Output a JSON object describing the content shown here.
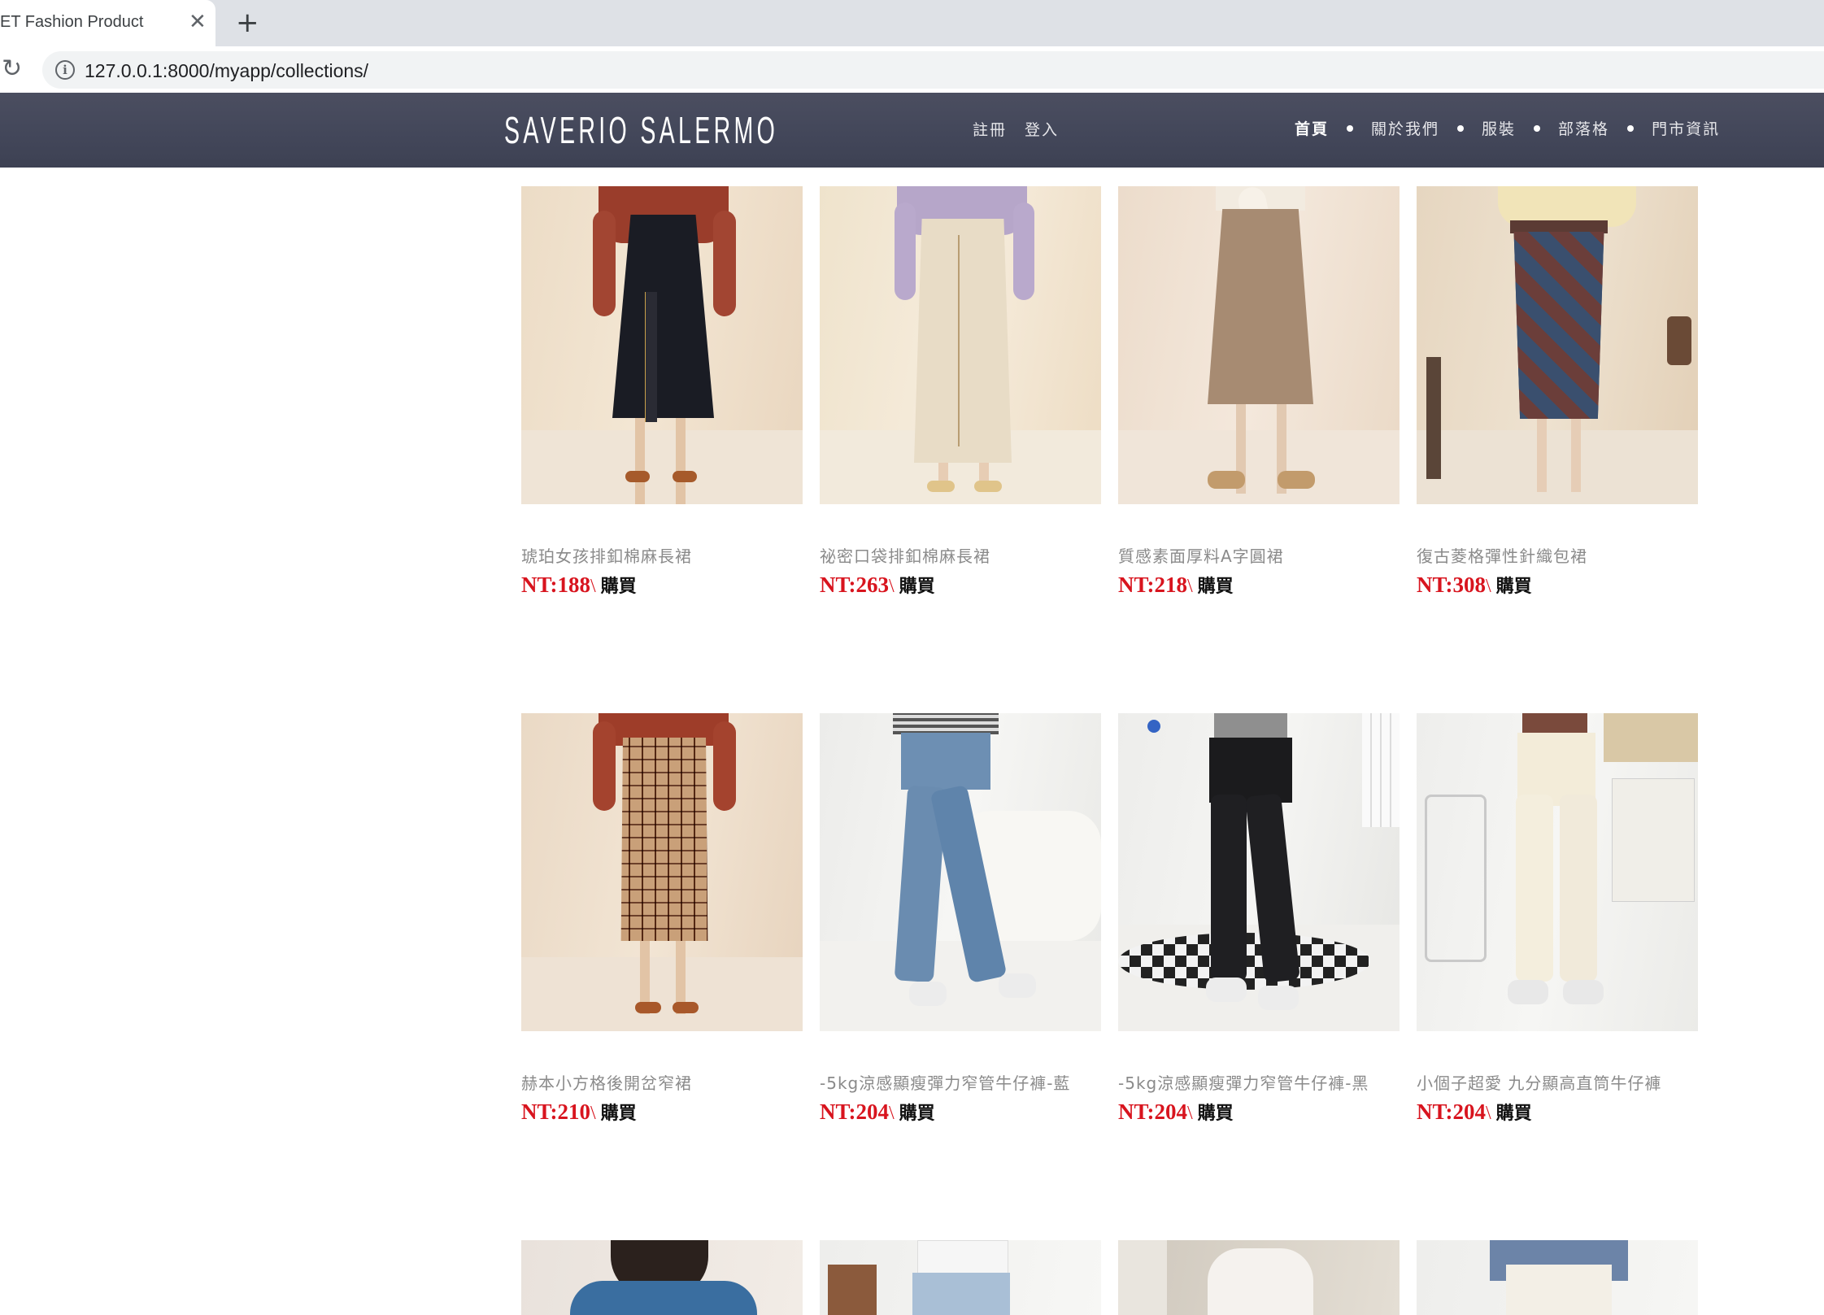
{
  "browser": {
    "tab_title": "ET Fashion Product",
    "close_glyph": "✕",
    "new_tab_glyph": "+",
    "reload_glyph": "↻",
    "info_glyph": "i",
    "url": "127.0.0.1:8000/myapp/collections/"
  },
  "header": {
    "logo": "SAVERIO SALERMO",
    "auth": [
      "註冊",
      "登入"
    ],
    "nav": [
      "首頁",
      "關於我們",
      "服裝",
      "部落格",
      "門市資訊"
    ]
  },
  "buy_label": "購買",
  "price_separator": "\\",
  "products": [
    {
      "name": "琥珀女孩排釦棉麻長裙",
      "price": "NT:188"
    },
    {
      "name": "祕密口袋排釦棉麻長裙",
      "price": "NT:263"
    },
    {
      "name": "質感素面厚料A字圓裙",
      "price": "NT:218"
    },
    {
      "name": "復古菱格彈性針織包裙",
      "price": "NT:308"
    },
    {
      "name": "赫本小方格後開岔窄裙",
      "price": "NT:210"
    },
    {
      "name": "-5kg涼感顯瘦彈力窄管牛仔褲-藍",
      "price": "NT:204"
    },
    {
      "name": "-5kg涼感顯瘦彈力窄管牛仔褲-黑",
      "price": "NT:204"
    },
    {
      "name": "小個子超愛 九分顯高直筒牛仔褲",
      "price": "NT:204"
    }
  ],
  "colors": {
    "header_bg": "#43475a",
    "price_red": "#d8141e"
  }
}
